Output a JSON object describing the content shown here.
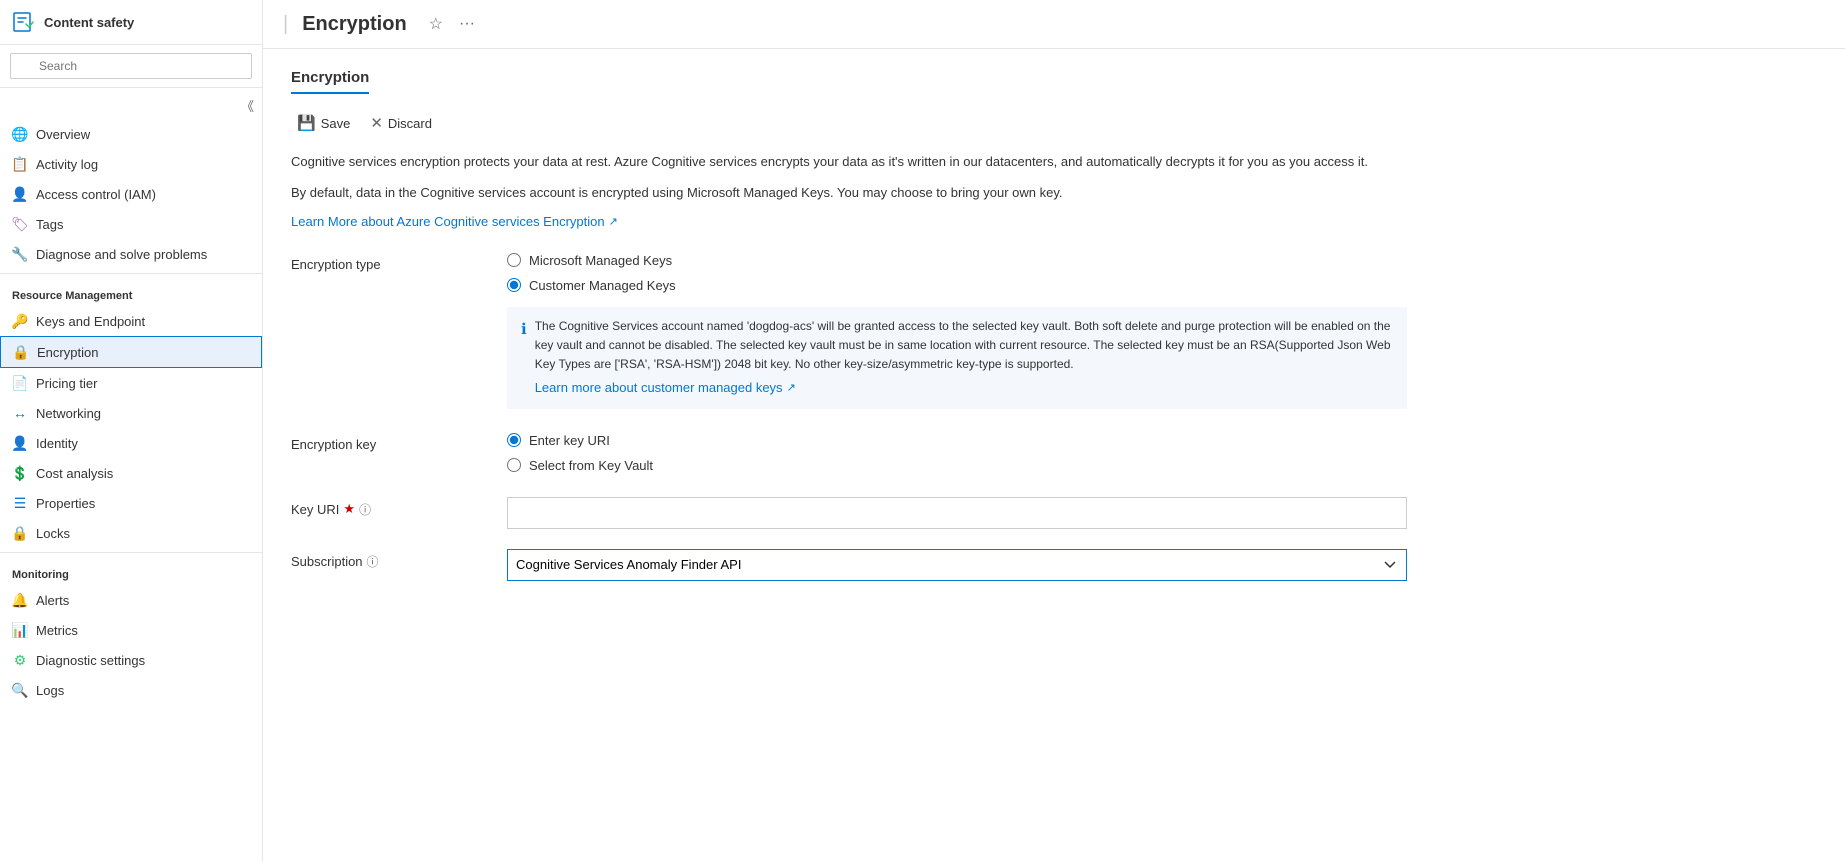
{
  "sidebar": {
    "logo_alt": "Content safety icon",
    "title": "Content safety",
    "search": {
      "placeholder": "Search"
    },
    "nav_items": [
      {
        "id": "overview",
        "label": "Overview",
        "icon": "🌐",
        "icon_color": "#17a",
        "active": false
      },
      {
        "id": "activity-log",
        "label": "Activity log",
        "icon": "📋",
        "icon_color": "#0078d4",
        "active": false
      },
      {
        "id": "access-control",
        "label": "Access control (IAM)",
        "icon": "👤",
        "icon_color": "#0078d4",
        "active": false
      },
      {
        "id": "tags",
        "label": "Tags",
        "icon": "🏷",
        "icon_color": "#9b59b6",
        "active": false
      },
      {
        "id": "diagnose",
        "label": "Diagnose and solve problems",
        "icon": "🔧",
        "icon_color": "#666",
        "active": false
      }
    ],
    "resource_management": {
      "label": "Resource Management",
      "items": [
        {
          "id": "keys-endpoint",
          "label": "Keys and Endpoint",
          "icon": "🔑",
          "icon_color": "#f0c000",
          "active": false
        },
        {
          "id": "encryption",
          "label": "Encryption",
          "icon": "🔒",
          "icon_color": "#e74c3c",
          "active": true
        },
        {
          "id": "pricing-tier",
          "label": "Pricing tier",
          "icon": "📄",
          "icon_color": "#0078d4",
          "active": false
        },
        {
          "id": "networking",
          "label": "Networking",
          "icon": "↔",
          "icon_color": "#0078d4",
          "active": false
        },
        {
          "id": "identity",
          "label": "Identity",
          "icon": "👤",
          "icon_color": "#0078d4",
          "active": false
        },
        {
          "id": "cost-analysis",
          "label": "Cost analysis",
          "icon": "💲",
          "icon_color": "#2ecc71",
          "active": false
        },
        {
          "id": "properties",
          "label": "Properties",
          "icon": "☰",
          "icon_color": "#0078d4",
          "active": false
        },
        {
          "id": "locks",
          "label": "Locks",
          "icon": "🔒",
          "icon_color": "#0078d4",
          "active": false
        }
      ]
    },
    "monitoring": {
      "label": "Monitoring",
      "items": [
        {
          "id": "alerts",
          "label": "Alerts",
          "icon": "🔔",
          "icon_color": "#2ecc71",
          "active": false
        },
        {
          "id": "metrics",
          "label": "Metrics",
          "icon": "📊",
          "icon_color": "#0078d4",
          "active": false
        },
        {
          "id": "diagnostic-settings",
          "label": "Diagnostic settings",
          "icon": "⚙",
          "icon_color": "#2ecc71",
          "active": false
        },
        {
          "id": "logs",
          "label": "Logs",
          "icon": "🔍",
          "icon_color": "#666",
          "active": false
        }
      ]
    }
  },
  "header": {
    "separator": "|",
    "title": "Encryption",
    "star_label": "Favorite",
    "more_label": "More"
  },
  "content": {
    "section_title": "Encryption",
    "toolbar": {
      "save_label": "Save",
      "discard_label": "Discard"
    },
    "description1": "Cognitive services encryption protects your data at rest. Azure Cognitive services encrypts your data as it's written in our datacenters, and automatically decrypts it for you as you access it.",
    "description2": "By default, data in the Cognitive services account is encrypted using Microsoft Managed Keys. You may choose to bring your own key.",
    "learn_more_link1": "Learn More about Azure Cognitive services Encryption",
    "encryption_type": {
      "label": "Encryption type",
      "options": [
        {
          "id": "microsoft-managed",
          "label": "Microsoft Managed Keys",
          "checked": false
        },
        {
          "id": "customer-managed",
          "label": "Customer Managed Keys",
          "checked": true
        }
      ],
      "info_text": "The Cognitive Services account named 'dogdog-acs' will be granted access to the selected key vault. Both soft delete and purge protection will be enabled on the key vault and cannot be disabled. The selected key vault must be in same location with current resource. The selected key must be an RSA(Supported Json Web Key Types are ['RSA', 'RSA-HSM']) 2048 bit key. No other key-size/asymmetric key-type is supported.",
      "learn_more_link2": "Learn more about customer managed keys"
    },
    "encryption_key": {
      "label": "Encryption key",
      "options": [
        {
          "id": "enter-key-uri",
          "label": "Enter key URI",
          "checked": true
        },
        {
          "id": "select-from-vault",
          "label": "Select from Key Vault",
          "checked": false
        }
      ]
    },
    "key_uri": {
      "label": "Key URI",
      "required": true,
      "placeholder": "",
      "info_tooltip": "Key URI tooltip"
    },
    "subscription": {
      "label": "Subscription",
      "info_tooltip": "Subscription tooltip",
      "value": "Cognitive Services Anomaly Finder API",
      "options": [
        "Cognitive Services Anomaly Finder API"
      ]
    }
  }
}
